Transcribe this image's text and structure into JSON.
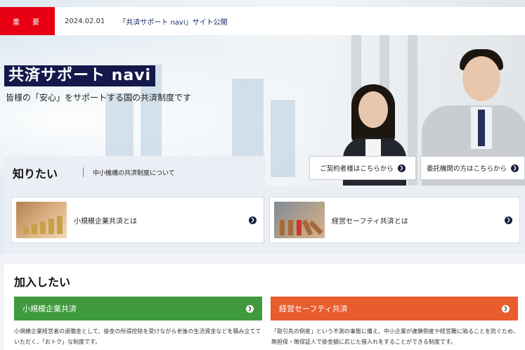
{
  "news": {
    "tag": "重　要",
    "date": "2024.02.01",
    "text": "「共済サポート navi」サイト公開"
  },
  "hero": {
    "title": "共済サポート navi",
    "subtitle": "皆様の「安心」をサポートする国の共済制度です"
  },
  "targets": {
    "contractor_label": "ご契約者様はこちらから",
    "agency_label": "委託機関の方はこちらから"
  },
  "know": {
    "title": "知りたい",
    "link": "中小機構の共済制度について",
    "cards": [
      {
        "label": "小規模企業共済とは"
      },
      {
        "label": "経営セーフティ共済とは"
      }
    ]
  },
  "join": {
    "title": "加入したい",
    "cards": [
      {
        "label": "小規模企業共済",
        "color": "#3f9a3d",
        "desc": "小規模企業経営者の退職金として、掛金の所得控除を受けながら老後の生活資金などを積み立てていただく、「おトク」な制度です。"
      },
      {
        "label": "経営セーフティ共済",
        "color": "#e85c2e",
        "desc": "「取引先の倒産」という不測の事態に備え、中小企業が連鎖倒産や経営難に陥ることを防ぐため、無担保・無保証人で掛金額に応じた借入れをすることができる制度です。"
      }
    ]
  },
  "icons": {
    "arrow": "chevron-right-icon"
  },
  "colors": {
    "accent_red": "#e60012",
    "navy": "#14184a"
  }
}
